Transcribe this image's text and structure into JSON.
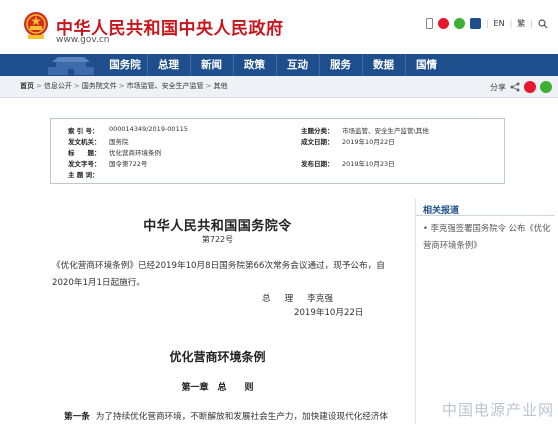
{
  "header": {
    "site_title": "中华人民共和国中央人民政府",
    "site_url": "www.gov.cn",
    "tools": [
      "EN",
      "繁"
    ]
  },
  "nav": {
    "items": [
      "国务院",
      "总理",
      "新闻",
      "政策",
      "互动",
      "服务",
      "数据",
      "国情"
    ]
  },
  "breadcrumb": {
    "items": [
      "首页",
      "信息公开",
      "国务院文件",
      "市场监管、安全生产监管",
      "其他"
    ],
    "share_label": "分享"
  },
  "meta": {
    "index_label": "索 引 号：",
    "index_value": "000014349/2019-00115",
    "subject_label": "主题分类：",
    "subject_value": "市场监管、安全生产监管\\其他",
    "issuer_label": "发文机关：",
    "issuer_value": "国务院",
    "created_label": "成文日期：",
    "created_value": "2019年10月22日",
    "title_label": "标　　题：",
    "title_value": "优化营商环境条例",
    "docno_label": "发文字号：",
    "docno_value": "国令第722号",
    "published_label": "发布日期：",
    "published_value": "2019年10月23日",
    "keywords_label": "主 题 词：",
    "keywords_value": ""
  },
  "document": {
    "title": "中华人民共和国国务院令",
    "number": "第722号",
    "paragraph": "《优化营商环境条例》已经2019年10月8日国务院第66次常务会议通过，现予公布，自2020年1月1日起施行。",
    "signer_title_1": "总",
    "signer_title_2": "理",
    "signer_name": "李克强",
    "sign_date": "2019年10月22日",
    "regulation_title": "优化营商环境条例",
    "chapter": "第一章　总　　则",
    "article_label": "第一条",
    "article_text": "为了持续优化营商环境，不断解放和发展社会生产力，加快建设现代化经济体"
  },
  "sidebar": {
    "title": "相关报道",
    "link": "李克强签署国务院令 公布《优化营商环境条例》"
  },
  "watermark": "中国电源产业网",
  "colors": {
    "brand_red": "#c8161d",
    "nav_blue": "#1f4e8c"
  }
}
